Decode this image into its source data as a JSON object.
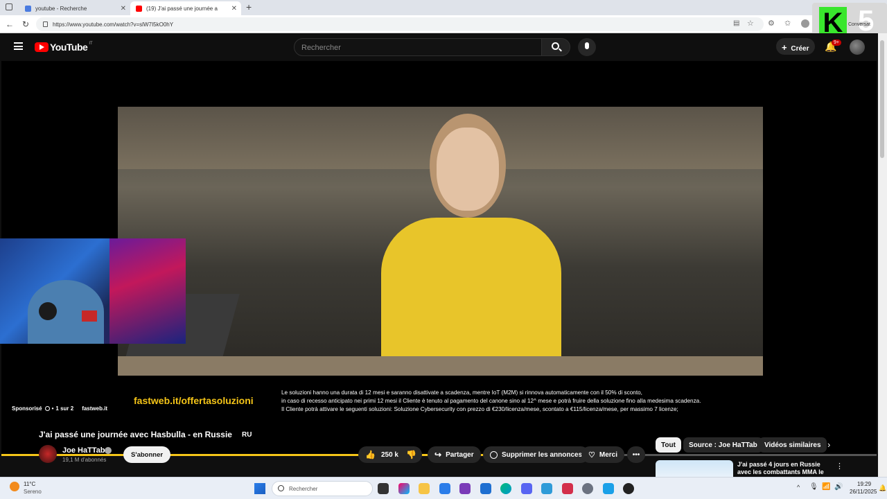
{
  "browser": {
    "tabs": [
      {
        "title": "youtube - Recherche",
        "active": false
      },
      {
        "title": "(19) J'ai passé une journée a",
        "active": true
      }
    ],
    "url": "https://www.youtube.com/watch?v=slW7I5kO0hY",
    "overlay_badge": "Conversat"
  },
  "youtube": {
    "logo": "YouTube",
    "region": "IT",
    "search_placeholder": "Rechercher",
    "create_label": "Créer",
    "notifications_count": "9+"
  },
  "ad": {
    "sponsor_label": "Sponsorisé",
    "ad_count": "1 sur 2",
    "advertiser": "fastweb.it",
    "headline_url": "fastweb.it/offertasoluzioni",
    "disclaimer_lines": [
      "Le soluzioni hanno una durata di 12 mesi e saranno disattivate a scadenza, mentre IoT (M2M) si rinnova automaticamente con il 50% di sconto,",
      "in caso di recesso anticipato nei primi 12 mesi il Cliente è tenuto al pagamento del canone sino al 12^ mese e potrà fruire della soluzione fino alla medesima scadenza.",
      "Il Cliente potrà attivare le seguenti soluzioni: Soluzione Cybersecurity con prezzo di €230/licenza/mese, scontato a €115/licenza/mese, per massimo 7 licenze;"
    ],
    "progress": 0.57
  },
  "video": {
    "title": "J'ai passé une journée avec Hasbulla - en Russie",
    "title_flag": "RU",
    "channel_name": "Joe HaTTab",
    "subscribers": "19,1 M d'abonnés",
    "subscribe_label": "S'abonner",
    "likes": "250 k",
    "share_label": "Partager",
    "remove_ads_label": "Supprimer les annonces",
    "thanks_label": "Merci"
  },
  "recommendations": {
    "chips": [
      "Tout",
      "Source : Joe HaTTab",
      "Vidéos similaires"
    ],
    "first_title": "J'ai passé 4 jours en Russie",
    "first_title_line2": "avec les combattants MMA le"
  },
  "taskbar": {
    "weather_temp": "11°C",
    "weather_desc": "Sereno",
    "search_placeholder": "Rechercher",
    "time": "19:29",
    "date": "26/11/2025"
  },
  "colors": {
    "youtube_red": "#ff0000",
    "ad_yellow": "#f5c518",
    "badge_green": "#39e62d"
  }
}
